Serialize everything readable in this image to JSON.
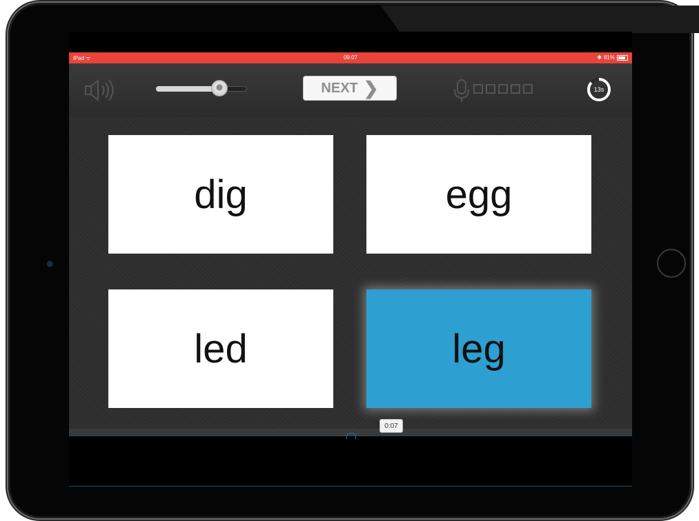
{
  "status_bar": {
    "device": "iPad",
    "time": "09:07",
    "battery": "81%"
  },
  "toolbar": {
    "volume_level": 0.7,
    "next_label": "NEXT",
    "mic_boxes": 5,
    "timer_label": "13s"
  },
  "cards": [
    {
      "word": "dig",
      "selected": false
    },
    {
      "word": "egg",
      "selected": false
    },
    {
      "word": "led",
      "selected": false
    },
    {
      "word": "leg",
      "selected": true
    }
  ],
  "video": {
    "timestamp": "0:07"
  },
  "colors": {
    "status_bar": "#e8443a",
    "selected_card": "#2e9fd1",
    "card": "#ffffff"
  }
}
